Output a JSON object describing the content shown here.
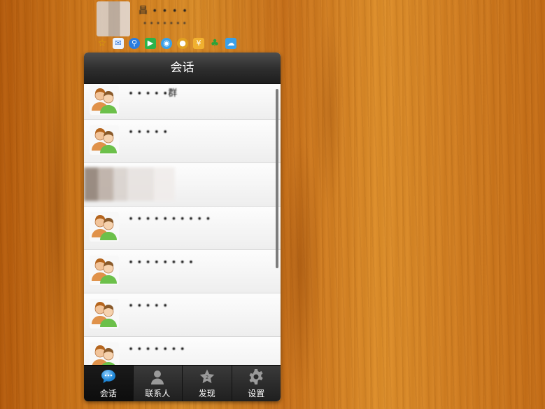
{
  "profile": {
    "nickname": "昌 ∙ ∙ ∙ ∙",
    "signature": "∙ ∙ ∙ ∙ ∙ ∙ ∙",
    "app_icons": [
      "favorite-icon",
      "mail-icon",
      "search-icon",
      "play-icon",
      "browser-icon",
      "game-icon",
      "wallet-icon",
      "clover-icon",
      "cloud-icon"
    ]
  },
  "window": {
    "title": "会话"
  },
  "conversations": [
    {
      "name": "∙ ∙ ∙ ∙ ∙群"
    },
    {
      "name": "∙ ∙ ∙ ∙ ∙"
    },
    {
      "name": ""
    },
    {
      "name": "∙ ∙ ∙ ∙ ∙ ∙ ∙ ∙ ∙ ∙"
    },
    {
      "name": "∙ ∙ ∙ ∙ ∙ ∙ ∙ ∙"
    },
    {
      "name": "∙ ∙ ∙ ∙ ∙"
    },
    {
      "name": "∙ ∙ ∙ ∙ ∙ ∙ ∙"
    }
  ],
  "tabs": [
    {
      "label": "会话",
      "icon": "chat-bubble-icon",
      "active": true
    },
    {
      "label": "联系人",
      "icon": "person-icon",
      "active": false
    },
    {
      "label": "发现",
      "icon": "star-icon",
      "active": false
    },
    {
      "label": "设置",
      "icon": "gear-icon",
      "active": false
    }
  ],
  "colors": {
    "accent_blue": "#3aa0e8",
    "title_bar": "#2d2d2d",
    "wood_background": "#d08024"
  }
}
